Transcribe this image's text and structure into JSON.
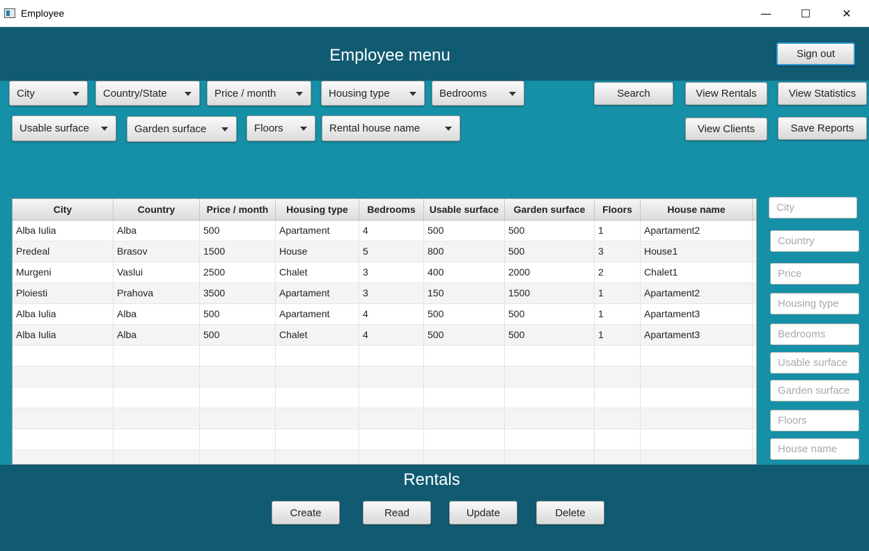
{
  "window": {
    "title": "Employee",
    "minimize_glyph": "—",
    "maximize_glyph": "☐",
    "close_glyph": "✕"
  },
  "header": {
    "title": "Employee menu",
    "signout_label": "Sign out"
  },
  "filters": {
    "row1": [
      "City",
      "Country/State",
      "Price / month",
      "Housing type",
      "Bedrooms"
    ],
    "row2": [
      "Usable surface",
      "Garden surface",
      "Floors",
      "Rental house name"
    ]
  },
  "actions": {
    "search": "Search",
    "view_rentals": "View Rentals",
    "view_statistics": "View Statistics",
    "view_clients": "View Clients",
    "save_reports": "Save Reports"
  },
  "table": {
    "columns": [
      "City",
      "Country",
      "Price / month",
      "Housing type",
      "Bedrooms",
      "Usable surface",
      "Garden surface",
      "Floors",
      "House name"
    ],
    "rows": [
      [
        "Alba Iulia",
        "Alba",
        "500",
        "Apartament",
        "4",
        "500",
        "500",
        "1",
        "Apartament2"
      ],
      [
        "Predeal",
        "Brasov",
        "1500",
        "House",
        "5",
        "800",
        "500",
        "3",
        "House1"
      ],
      [
        "Murgeni",
        "Vaslui",
        "2500",
        "Chalet",
        "3",
        "400",
        "2000",
        "2",
        "Chalet1"
      ],
      [
        "Ploiesti",
        "Prahova",
        "3500",
        "Apartament",
        "3",
        "150",
        "1500",
        "1",
        "Apartament2"
      ],
      [
        "Alba Iulia",
        "Alba",
        "500",
        "Apartament",
        "4",
        "500",
        "500",
        "1",
        "Apartament3"
      ],
      [
        "Alba Iulia",
        "Alba",
        "500",
        "Chalet",
        "4",
        "500",
        "500",
        "1",
        "Apartament3"
      ],
      [
        "",
        "",
        "",
        "",
        "",
        "",
        "",
        "",
        ""
      ],
      [
        "",
        "",
        "",
        "",
        "",
        "",
        "",
        "",
        ""
      ],
      [
        "",
        "",
        "",
        "",
        "",
        "",
        "",
        "",
        ""
      ],
      [
        "",
        "",
        "",
        "",
        "",
        "",
        "",
        "",
        ""
      ],
      [
        "",
        "",
        "",
        "",
        "",
        "",
        "",
        "",
        ""
      ],
      [
        "",
        "",
        "",
        "",
        "",
        "",
        "",
        "",
        ""
      ]
    ]
  },
  "side_inputs": {
    "city": "City",
    "country": "Country",
    "price": "Price",
    "housing_type": "Housing type",
    "bedrooms": "Bedrooms",
    "usable_surface": "Usable surface",
    "garden_surface": "Garden surface",
    "floors": "Floors",
    "house_name": "House name"
  },
  "footer": {
    "title": "Rentals",
    "create": "Create",
    "read": "Read",
    "update": "Update",
    "delete": "Delete"
  }
}
